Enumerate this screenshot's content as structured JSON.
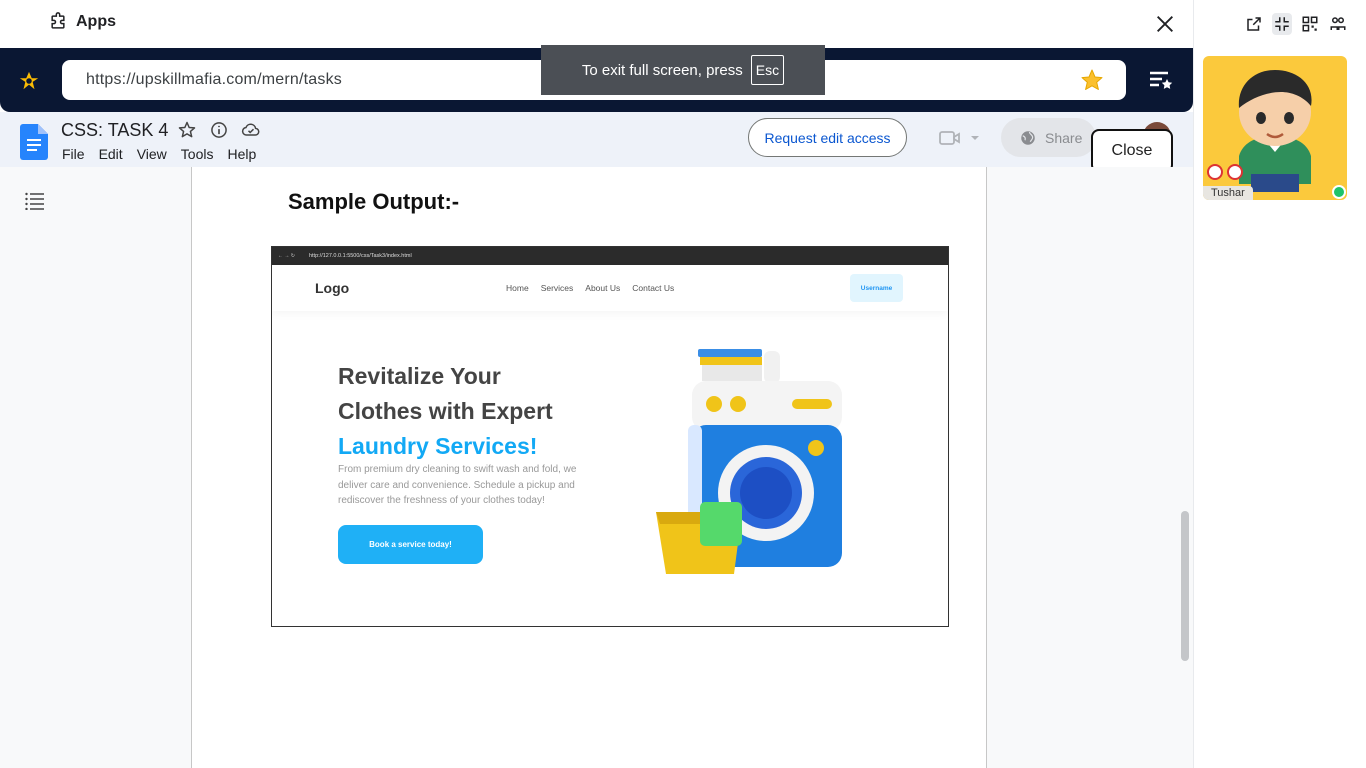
{
  "apps_bar": {
    "title": "Apps"
  },
  "address_bar": {
    "url": "https://upskillmafia.com/mern/tasks"
  },
  "fullscreen_toast": {
    "text": "To exit full screen, press",
    "key": "Esc"
  },
  "docs": {
    "title": "CSS: TASK 4",
    "menus": [
      "File",
      "Edit",
      "View",
      "Tools",
      "Help"
    ],
    "request_edit": "Request edit access",
    "share": "Share",
    "close": "Close"
  },
  "page": {
    "heading": "Sample Output:-",
    "screenshot": {
      "url": "http://127.0.0.1:5500/css/Task3/index.html",
      "logo": "Logo",
      "nav": [
        "Home",
        "Services",
        "About Us",
        "Contact Us"
      ],
      "username": "Username",
      "headline_1": "Revitalize Your",
      "headline_2": "Clothes with Expert",
      "headline_3": "Laundry Services!",
      "paragraph": "From premium dry cleaning to swift wash and fold, we deliver care and convenience. Schedule a pickup and rediscover the freshness of your clothes today!",
      "cta": "Book a service today!"
    }
  },
  "participant": {
    "name": "Tushar",
    "online": true
  },
  "colors": {
    "accent": "#12a9f5",
    "navy": "#0a1733",
    "docs_blue": "#0b57d0",
    "tile": "#fbc93c"
  }
}
